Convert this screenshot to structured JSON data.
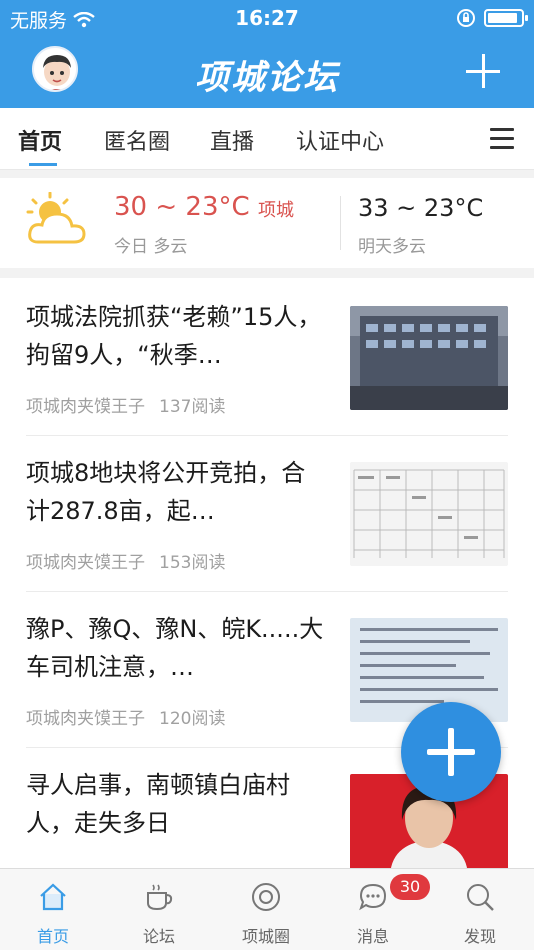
{
  "status_bar": {
    "carrier": "无服务",
    "time": "16:27",
    "battery_level": 0.92
  },
  "header": {
    "title": "项城论坛"
  },
  "tabs": [
    {
      "label": "首页"
    },
    {
      "label": "匿名圈"
    },
    {
      "label": "直播"
    },
    {
      "label": "认证中心"
    }
  ],
  "weather": {
    "today_temp": "30 ~ 23°C",
    "city": "项城",
    "today_desc": "今日 多云",
    "tomorrow_temp": "33 ~ 23°C",
    "tomorrow_desc": "明天多云"
  },
  "articles": [
    {
      "title": "项城法院抓获“老赖”15人，拘留9人，“秋季…",
      "author": "项城肉夹馍王子",
      "reads": "137阅读"
    },
    {
      "title": "项城8地块将公开竞拍，合计287.8亩，起…",
      "author": "项城肉夹馍王子",
      "reads": "153阅读"
    },
    {
      "title": "豫P、豫Q、豫N、皖K.....大车司机注意，…",
      "author": "项城肉夹馍王子",
      "reads": "120阅读"
    },
    {
      "title": "寻人启事，南顿镇白庙村人，走失多日",
      "author": "",
      "reads": ""
    }
  ],
  "tabbar": {
    "items": [
      {
        "label": "首页"
      },
      {
        "label": "论坛"
      },
      {
        "label": "项城圈"
      },
      {
        "label": "消息"
      },
      {
        "label": "发现"
      }
    ],
    "message_badge": "30"
  },
  "colors": {
    "primary": "#3a9ce6",
    "fab": "#2f8fe0",
    "badge": "#e0393e",
    "weather_today": "#d9534f"
  }
}
